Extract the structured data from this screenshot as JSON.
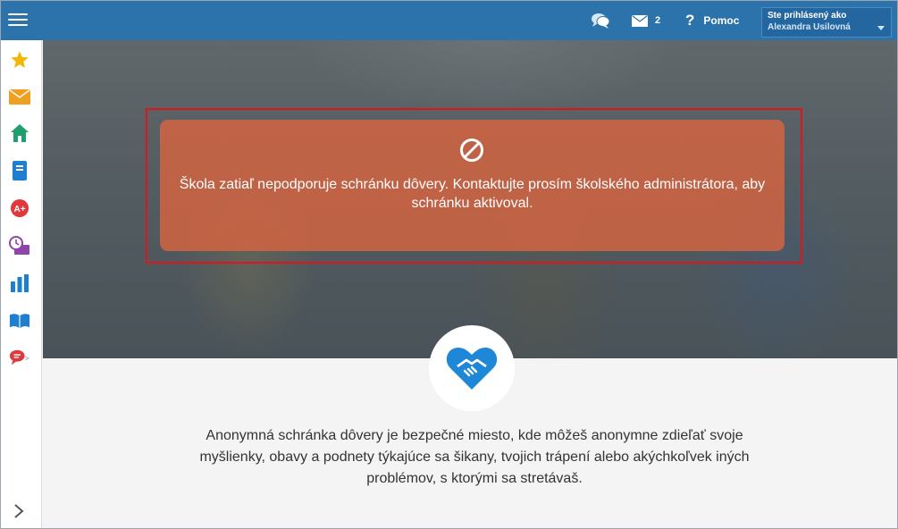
{
  "topbar": {
    "menu_icon": "hamburger-icon",
    "chat_icon": "chat-bubbles-icon",
    "mail_icon": "envelope-icon",
    "mail_count": "2",
    "help_label": "Pomoc",
    "user_label": "Ste prihlásený ako",
    "user_name": "Alexandra Usilovná"
  },
  "sidebar": {
    "items": [
      {
        "icon": "star-icon",
        "color": "#f2b705"
      },
      {
        "icon": "envelope-icon",
        "color": "#f0a020"
      },
      {
        "icon": "home-icon",
        "color": "#1f9e6e"
      },
      {
        "icon": "notebook-icon",
        "color": "#1e7fd0"
      },
      {
        "icon": "grade-icon",
        "color": "#e0383b"
      },
      {
        "icon": "schedule-icon",
        "color": "#8e44ad"
      },
      {
        "icon": "bar-chart-icon",
        "color": "#1e7fd0"
      },
      {
        "icon": "open-book-icon",
        "color": "#1e7fd0"
      },
      {
        "icon": "speech-bubbles-icon",
        "color": "#e0383b"
      }
    ],
    "expand_icon": "chevron-right-icon"
  },
  "alert": {
    "icon": "ban-icon",
    "message": "Škola zatiaľ nepodporuje schránku dôvery. Kontaktujte prosím školského administrátora, aby schránku aktivoval."
  },
  "badge_icon": "heart-handshake-icon",
  "description": "Anonymná schránka dôvery je bezpečné miesto, kde môžeš anonymne zdieľať svoje myšlienky, obavy a podnety týkajúce sa šikany, tvojich trápení alebo akýchkoľvek iných problémov, s ktorými sa stretávaš.",
  "colors": {
    "topbar": "#2d73ab",
    "alert": "#d76441",
    "accent": "#1e88d6"
  }
}
